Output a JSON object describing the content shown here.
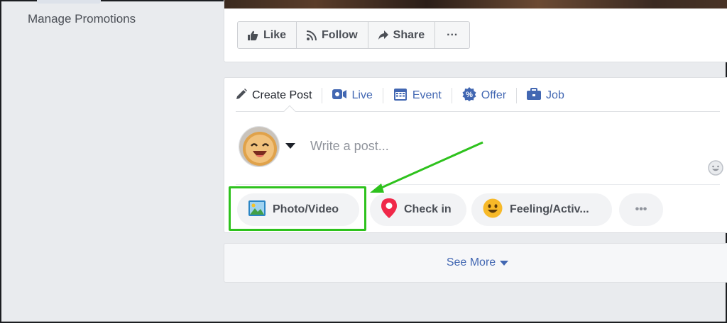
{
  "sidebar": {
    "manage_promotions": "Manage Promotions"
  },
  "page_actions": {
    "like": "Like",
    "follow": "Follow",
    "share": "Share",
    "more": "···"
  },
  "composer": {
    "tabs": [
      {
        "label": "Create Post",
        "icon": "pencil-icon"
      },
      {
        "label": "Live",
        "icon": "live-video-icon"
      },
      {
        "label": "Event",
        "icon": "calendar-icon"
      },
      {
        "label": "Offer",
        "icon": "offer-percent-icon"
      },
      {
        "label": "Job",
        "icon": "briefcase-icon"
      }
    ],
    "placeholder": "Write a post...",
    "actions": {
      "photo_video": "Photo/Video",
      "check_in": "Check in",
      "feeling": "Feeling/Activ...",
      "more": "•••"
    }
  },
  "see_more": "See More",
  "colors": {
    "accent": "#4267b2",
    "highlight": "#2ec21d",
    "background": "#e9ebee"
  }
}
